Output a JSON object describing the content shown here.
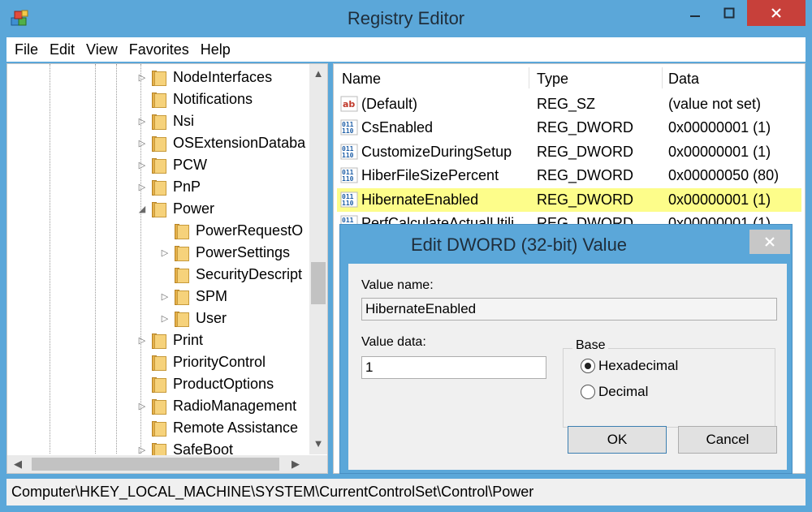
{
  "window": {
    "title": "Registry Editor",
    "icon": "registry-cubes-icon"
  },
  "menu": [
    "File",
    "Edit",
    "View",
    "Favorites",
    "Help"
  ],
  "tree": {
    "items": [
      {
        "label": "NodeInterfaces",
        "expander": "▷"
      },
      {
        "label": "Notifications",
        "expander": ""
      },
      {
        "label": "Nsi",
        "expander": "▷"
      },
      {
        "label": "OSExtensionDataba",
        "expander": "▷"
      },
      {
        "label": "PCW",
        "expander": "▷"
      },
      {
        "label": "PnP",
        "expander": "▷"
      },
      {
        "label": "Power",
        "expander": "◢"
      },
      {
        "label": "PowerRequestO",
        "expander": ""
      },
      {
        "label": "PowerSettings",
        "expander": "▷"
      },
      {
        "label": "SecurityDescript",
        "expander": ""
      },
      {
        "label": "SPM",
        "expander": "▷"
      },
      {
        "label": "User",
        "expander": "▷"
      },
      {
        "label": "Print",
        "expander": "▷"
      },
      {
        "label": "PriorityControl",
        "expander": ""
      },
      {
        "label": "ProductOptions",
        "expander": ""
      },
      {
        "label": "RadioManagement",
        "expander": "▷"
      },
      {
        "label": "Remote Assistance",
        "expander": ""
      },
      {
        "label": "SafeBoot",
        "expander": "▷"
      }
    ]
  },
  "list": {
    "headers": {
      "name": "Name",
      "type": "Type",
      "data": "Data"
    },
    "rows": [
      {
        "name": "(Default)",
        "type": "REG_SZ",
        "data": "(value not set)",
        "icon": "string-value-icon"
      },
      {
        "name": "CsEnabled",
        "type": "REG_DWORD",
        "data": "0x00000001 (1)",
        "icon": "binary-value-icon"
      },
      {
        "name": "CustomizeDuringSetup",
        "type": "REG_DWORD",
        "data": "0x00000001 (1)",
        "icon": "binary-value-icon"
      },
      {
        "name": "HiberFileSizePercent",
        "type": "REG_DWORD",
        "data": "0x00000050 (80)",
        "icon": "binary-value-icon"
      },
      {
        "name": "HibernateEnabled",
        "type": "REG_DWORD",
        "data": "0x00000001 (1)",
        "icon": "binary-value-icon"
      },
      {
        "name": "PerfCalculateActualUtili",
        "type": "REG_DWORD",
        "data": "0x00000001 (1)",
        "icon": "binary-value-icon"
      }
    ]
  },
  "dialog": {
    "title": "Edit DWORD (32-bit) Value",
    "value_name_label": "Value name:",
    "value_name": "HibernateEnabled",
    "value_data_label": "Value data:",
    "value_data": "1",
    "base_label": "Base",
    "hex_label": "Hexadecimal",
    "dec_label": "Decimal",
    "selected_base": "Hexadecimal",
    "ok_label": "OK",
    "cancel_label": "Cancel"
  },
  "statusbar": {
    "path": "Computer\\HKEY_LOCAL_MACHINE\\SYSTEM\\CurrentControlSet\\Control\\Power"
  },
  "colors": {
    "chrome": "#5ba7d9",
    "close_button": "#c7403a",
    "highlight_row": "#fdfd8a"
  }
}
